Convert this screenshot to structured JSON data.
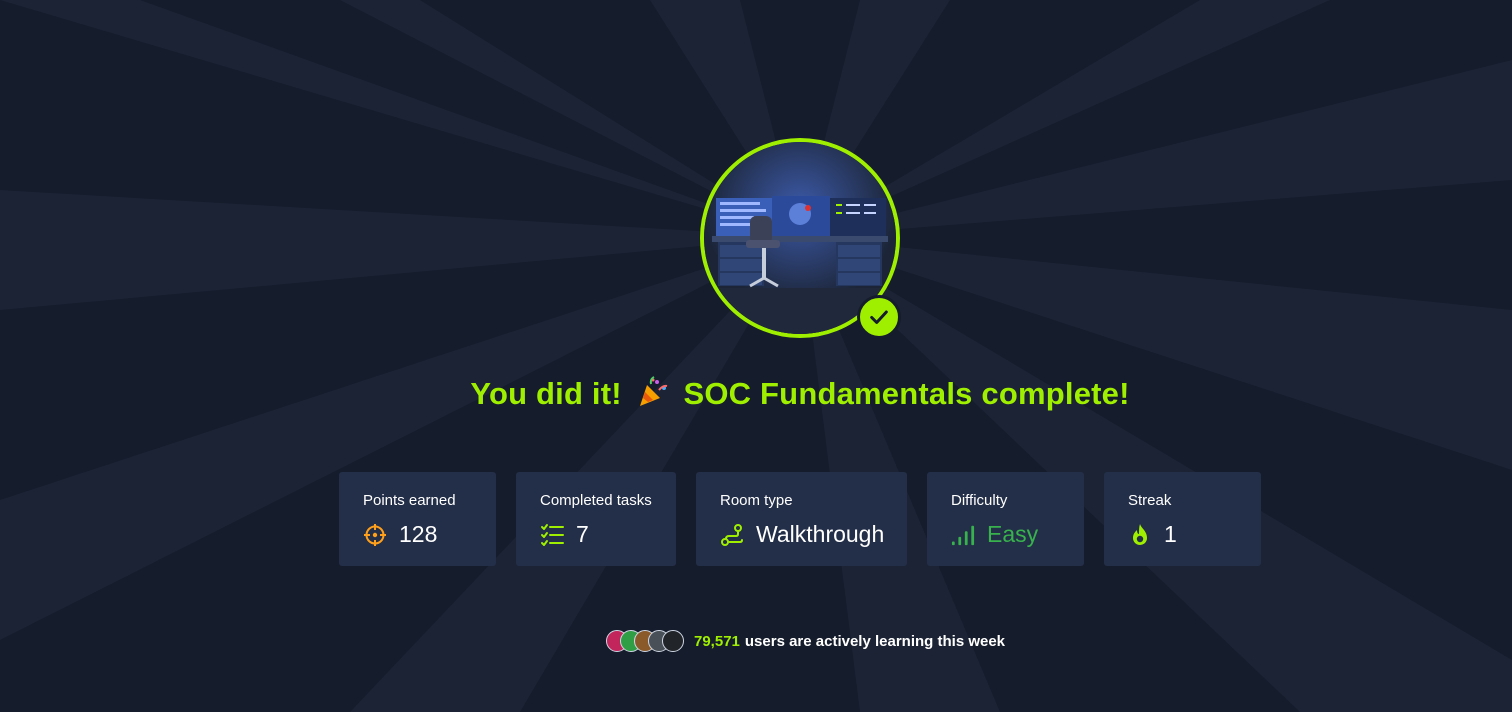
{
  "headline": {
    "text_before": "You did it!",
    "text_after": "SOC Fundamentals complete!"
  },
  "stats": [
    {
      "label": "Points earned",
      "value": "128",
      "icon": "crosshair-icon"
    },
    {
      "label": "Completed tasks",
      "value": "7",
      "icon": "checklist-icon"
    },
    {
      "label": "Room type",
      "value": "Walkthrough",
      "icon": "route-icon"
    },
    {
      "label": "Difficulty",
      "value": "Easy",
      "icon": "signal-bars-icon"
    },
    {
      "label": "Streak",
      "value": "1",
      "icon": "flame-icon"
    }
  ],
  "footer": {
    "count": "79,571",
    "text": "users are actively learning this week"
  },
  "colors": {
    "accent": "#9fef00",
    "background": "#151c2b",
    "card": "#232f48",
    "points": "#ff9f1a",
    "easy": "#37b24d"
  }
}
